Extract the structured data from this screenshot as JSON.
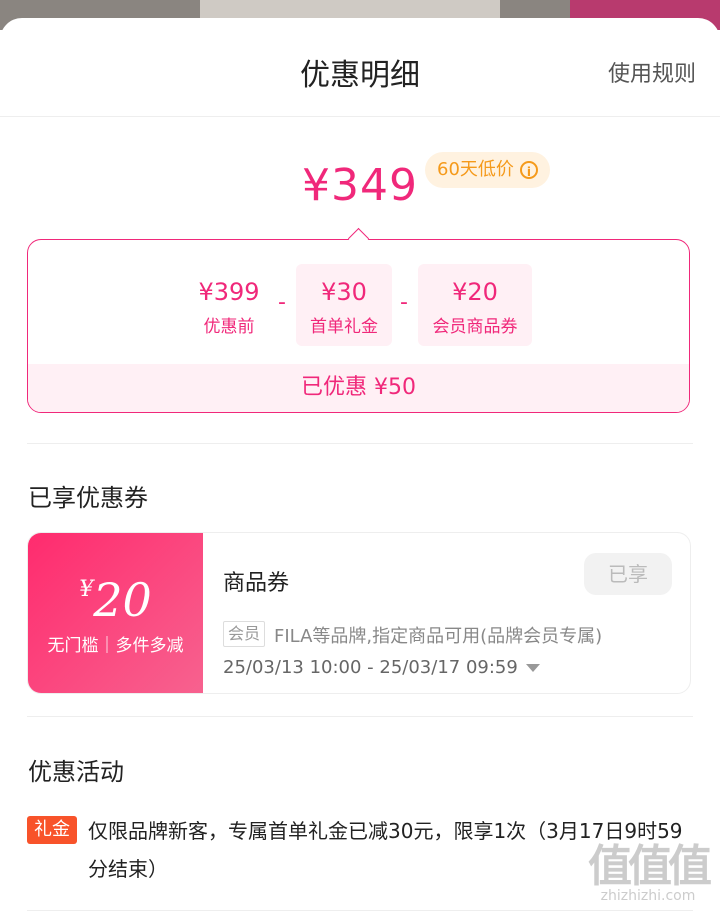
{
  "header": {
    "title": "优惠明细",
    "rules_link": "使用规则"
  },
  "price": {
    "current": "¥349",
    "badge": "60天低价",
    "badge_icon": "info-icon"
  },
  "breakdown": {
    "original": {
      "amount": "¥399",
      "label": "优惠前"
    },
    "op1": "-",
    "first_order": {
      "amount": "¥30",
      "label": "首单礼金"
    },
    "op2": "-",
    "member_coupon": {
      "amount": "¥20",
      "label": "会员商品券"
    },
    "total": "已优惠 ¥50"
  },
  "coupons_section": {
    "title": "已享优惠券",
    "coupon": {
      "currency": "¥",
      "amount": "20",
      "condition": "无门槛｜多件多减",
      "name": "商品券",
      "status": "已享",
      "tag": "会员",
      "description": "FILA等品牌,指定商品可用(品牌会员专属)",
      "validity": "25/03/13 10:00 - 25/03/17 09:59"
    }
  },
  "activities_section": {
    "title": "优惠活动",
    "item": {
      "tag": "礼金",
      "text": "仅限品牌新客，专属首单礼金已减30元，限享1次（3月17日9时59分结束）"
    }
  },
  "watermark": {
    "logo": "值值值",
    "site": "zhizhizhi.com"
  },
  "colors": {
    "accent": "#f0287a",
    "badge_orange": "#f59a1b",
    "promo_tag": "#f8532a"
  }
}
